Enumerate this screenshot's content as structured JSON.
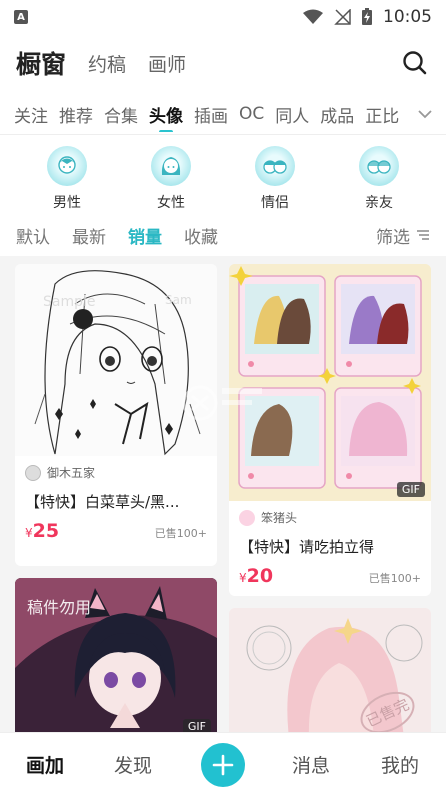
{
  "status_bar": {
    "time": "10:05",
    "app_icon_letter": "A"
  },
  "header": {
    "tabs": [
      {
        "label": "橱窗",
        "active": true
      },
      {
        "label": "约稿",
        "active": false
      },
      {
        "label": "画师",
        "active": false
      }
    ]
  },
  "categories": [
    {
      "label": "关注",
      "active": false
    },
    {
      "label": "推荐",
      "active": false
    },
    {
      "label": "合集",
      "active": false
    },
    {
      "label": "头像",
      "active": true
    },
    {
      "label": "插画",
      "active": false
    },
    {
      "label": "OC",
      "active": false
    },
    {
      "label": "同人",
      "active": false
    },
    {
      "label": "成品",
      "active": false
    },
    {
      "label": "正比",
      "active": false
    }
  ],
  "subcategories": [
    {
      "label": "男性",
      "icon": "male-avatar-icon"
    },
    {
      "label": "女性",
      "icon": "female-avatar-icon"
    },
    {
      "label": "情侣",
      "icon": "couple-avatar-icon"
    },
    {
      "label": "亲友",
      "icon": "friends-avatar-icon"
    }
  ],
  "sort": {
    "options": [
      {
        "label": "默认",
        "active": false
      },
      {
        "label": "最新",
        "active": false
      },
      {
        "label": "销量",
        "active": true
      },
      {
        "label": "收藏",
        "active": false
      }
    ],
    "filter_label": "筛选"
  },
  "cards": [
    {
      "author": "御木五家",
      "title": "【特快】白菜草头/黑...",
      "price_symbol": "¥",
      "price": "25",
      "sold": "已售100+",
      "gif": ""
    },
    {
      "author": "笨猪头",
      "title": "【特快】请吃拍立得",
      "price_symbol": "¥",
      "price": "20",
      "sold": "已售100+",
      "gif": "GIF"
    },
    {
      "watermark": "稿件勿用",
      "gif": "GIF"
    },
    {
      "stamp": "已售完"
    }
  ],
  "bottom_nav": {
    "items": [
      {
        "label": "画加",
        "active": true
      },
      {
        "label": "发现",
        "active": false
      },
      {
        "label": "消息",
        "active": false
      },
      {
        "label": "我的",
        "active": false
      }
    ]
  },
  "colors": {
    "accent": "#22c1d0",
    "price": "#f0365c",
    "active_sort": "#2bb8c4"
  }
}
